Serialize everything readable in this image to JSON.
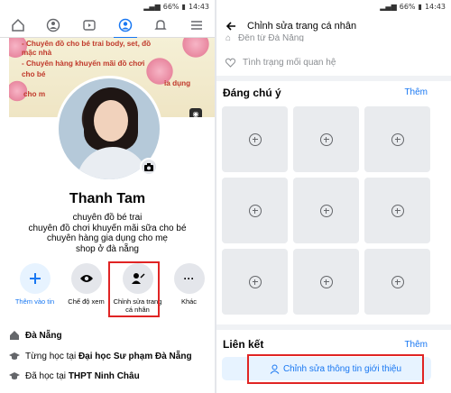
{
  "status": {
    "battery": "66%",
    "time": "14:43"
  },
  "left": {
    "cover_lines": [
      "- Chuyên đồ cho bé trai body, set, đồ",
      "mặc nhà",
      "- Chuyên hàng khuyến mãi đồ chơi",
      "cho bé",
      "ia dụng",
      "cho m"
    ],
    "name": "Thanh Tam",
    "bio": [
      "chuyên đồ bé trai",
      "chuyên đồ chơi khuyến mãi sữa cho bé",
      "chuyên hàng gia dụng cho mẹ",
      "shop ở đà nẵng"
    ],
    "actions": [
      {
        "label": "Thêm vào tin"
      },
      {
        "label": "Chế độ xem"
      },
      {
        "label": "Chỉnh sửa trang cá nhân"
      },
      {
        "label": "Khác"
      }
    ],
    "info": {
      "location": "Đà Nẵng",
      "study_prefix": "Từng học tại ",
      "study_school": "Đại học Sư phạm Đà Nẵng",
      "hs_prefix": "Đã học tại ",
      "hs_school": "THPT Ninh Châu"
    }
  },
  "right": {
    "title": "Chỉnh sửa trang cá nhân",
    "faded_top": "Đến từ Đà Nẵng",
    "relationship": "Tình trạng mối quan hệ",
    "featured_title": "Đáng chú ý",
    "featured_link": "Thêm",
    "links_title": "Liên kết",
    "links_link": "Thêm",
    "edit_intro": "Chỉnh sửa thông tin giới thiệu"
  },
  "colors": {
    "accent": "#1877f2",
    "highlight": "#e02424"
  }
}
